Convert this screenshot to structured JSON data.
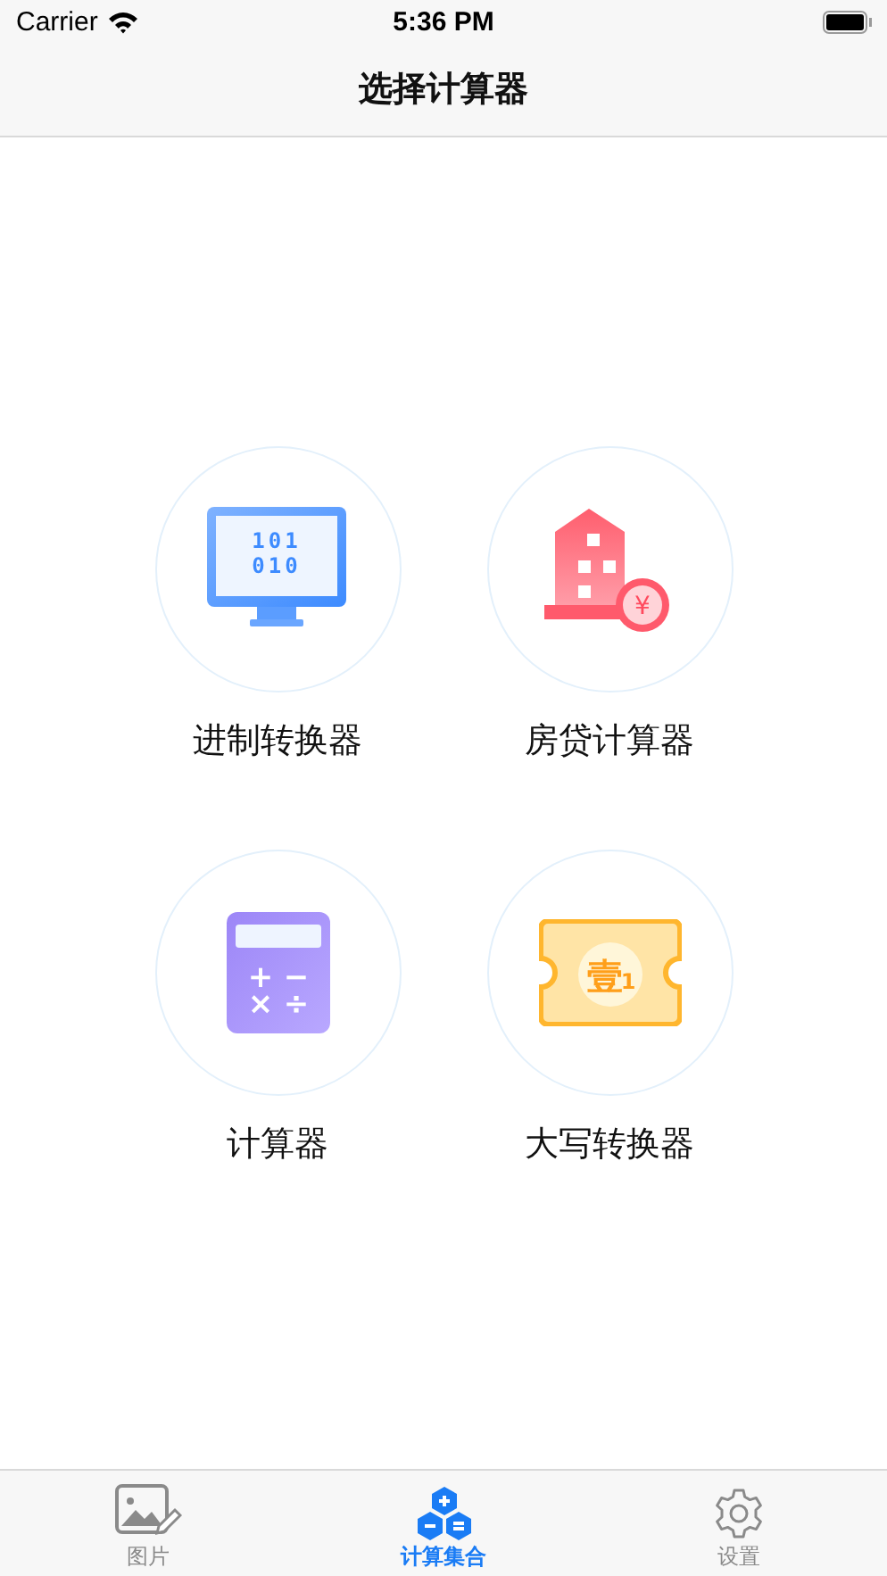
{
  "status_bar": {
    "carrier": "Carrier",
    "time": "5:36 PM"
  },
  "nav_bar": {
    "title": "选择计算器"
  },
  "tools": [
    {
      "kind": "binary",
      "label": "进制转换器",
      "icon_text": [
        "101",
        "010"
      ]
    },
    {
      "kind": "mortgage",
      "label": "房贷计算器",
      "icon_text": [
        "¥"
      ]
    },
    {
      "kind": "calculator",
      "label": "计算器",
      "icon_text": [
        "+",
        "−",
        "×",
        "÷"
      ]
    },
    {
      "kind": "capital",
      "label": "大写转换器",
      "icon_text": [
        "壹",
        "1"
      ]
    }
  ],
  "tab_bar": [
    {
      "kind": "picture",
      "label": "图片",
      "selected": false
    },
    {
      "kind": "calc",
      "label": "计算集合",
      "selected": true
    },
    {
      "kind": "settings",
      "label": "设置",
      "selected": false
    }
  ]
}
